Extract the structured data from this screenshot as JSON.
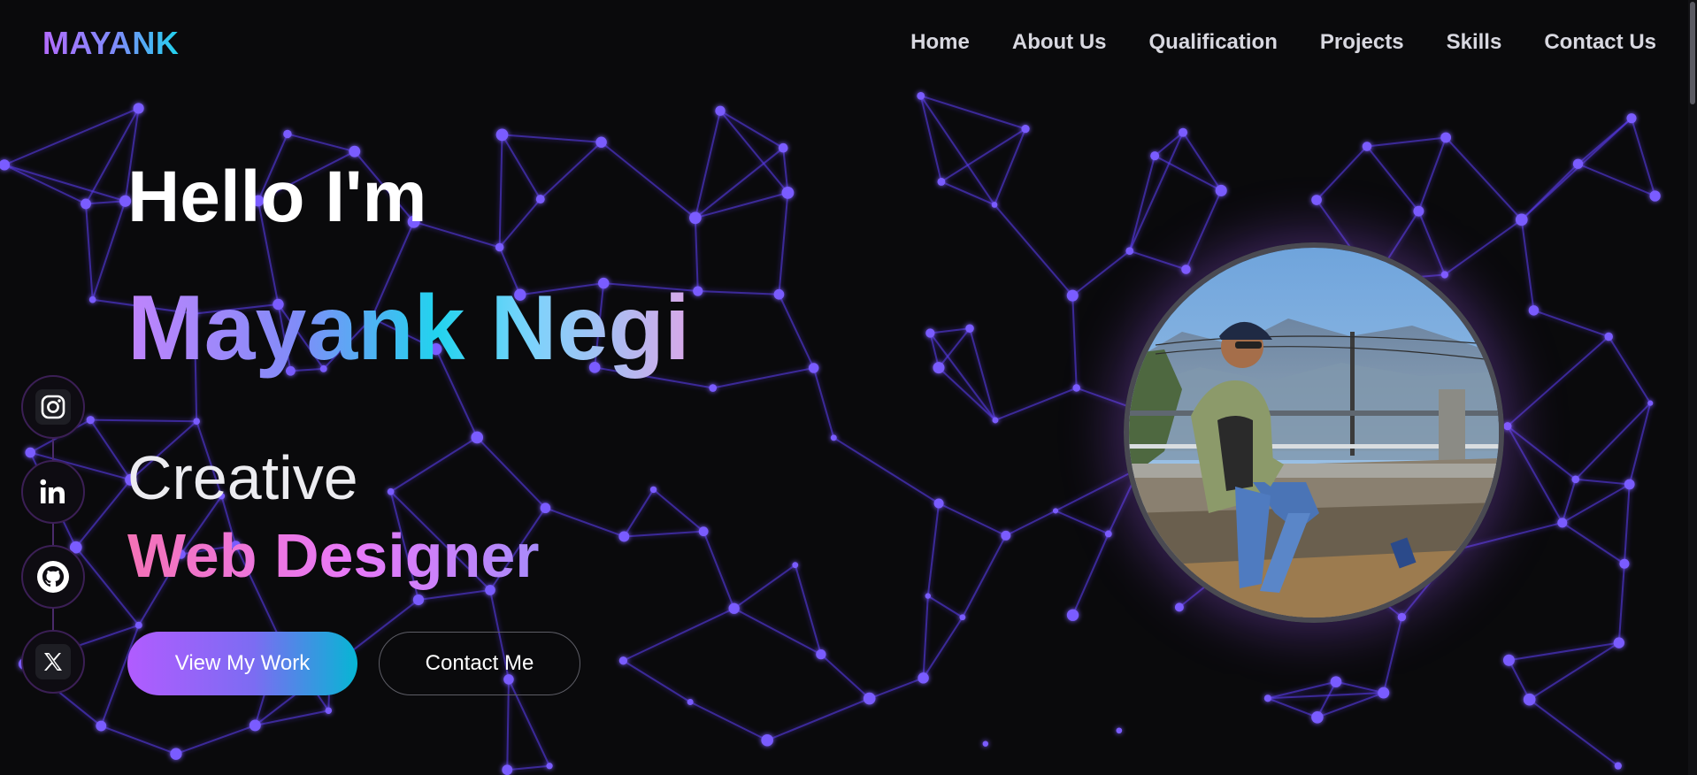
{
  "header": {
    "brand": "MAYANK",
    "nav": [
      "Home",
      "About Us",
      "Qualification",
      "Projects",
      "Skills",
      "Contact Us"
    ]
  },
  "hero": {
    "greeting": "Hello I'm",
    "name": "Mayank Negi",
    "role_line1": "Creative",
    "role_line2": "Web Designer",
    "primary_button": "View My Work",
    "secondary_button": "Contact Me"
  },
  "socials": [
    "instagram-icon",
    "linkedin-icon",
    "github-icon",
    "x-icon"
  ],
  "portrait": {
    "description_icon": "profile-photo"
  },
  "colors": {
    "background": "#0a0a0c",
    "network": "#6a3cff",
    "accent_purple": "#b15cff",
    "accent_cyan": "#06b6d4",
    "accent_pink": "#f472b6"
  }
}
